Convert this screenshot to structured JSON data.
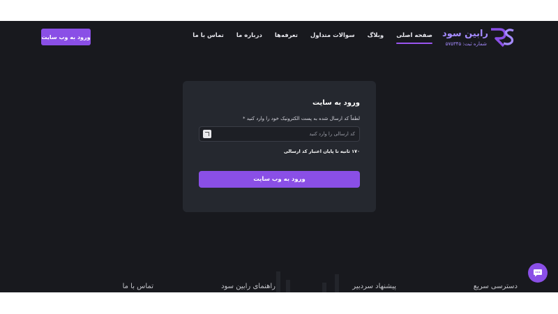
{
  "brand": {
    "name": "رابین سود",
    "registration": "شماره ثبت: ۵۷۵۳۴۵"
  },
  "nav": {
    "items": [
      {
        "label": "صفحه اصلی",
        "active": true
      },
      {
        "label": "وبلاگ",
        "active": false
      },
      {
        "label": "سوالات متداول",
        "active": false
      },
      {
        "label": "تعرفه‌ها",
        "active": false
      },
      {
        "label": "درباره ما",
        "active": false
      },
      {
        "label": "تماس با ما",
        "active": false
      }
    ],
    "login_button": "ورود به وب سایت"
  },
  "login_card": {
    "title": "ورود به سایت",
    "instruction": "لطفاً کد ارسال شده به پست الکترونیک خود را وارد کنید *",
    "code_placeholder": "کد ارسالی را وارد کنید",
    "countdown": "۱۷۰ ثانیه تا پایان اعتبار کد ارسالی",
    "submit_label": "ورود به وب سایت"
  },
  "footer": {
    "headings": [
      "دسترسی سریع",
      "پیشنهاد سردبیر",
      "راهنمای رابین سود",
      "تماس با ما"
    ]
  },
  "colors": {
    "background": "#18191e",
    "card": "#25282f",
    "accent": "#8a4fe6",
    "logo": "#a58bff"
  },
  "icons": {
    "logo": "rs-monogram-icon",
    "input_prefix": "copy-code-icon",
    "chat": "chat-bubble-icon"
  }
}
